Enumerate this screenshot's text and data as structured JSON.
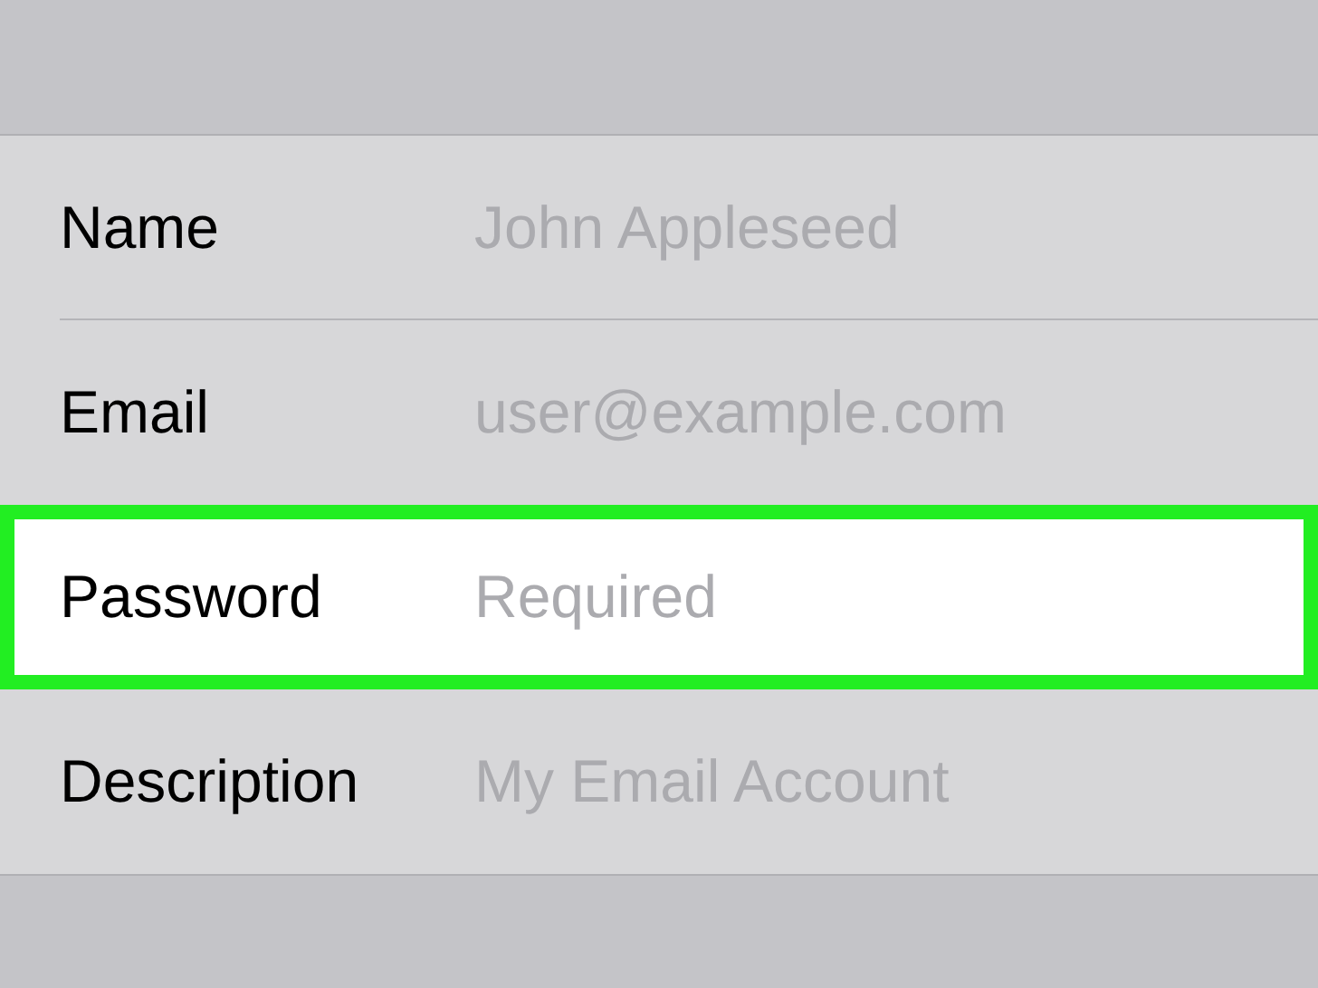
{
  "rows": [
    {
      "label": "Name",
      "placeholder": "John Appleseed",
      "highlighted": false
    },
    {
      "label": "Email",
      "placeholder": "user@example.com",
      "highlighted": false
    },
    {
      "label": "Password",
      "placeholder": "Required",
      "highlighted": true
    },
    {
      "label": "Description",
      "placeholder": "My Email Account",
      "highlighted": false
    }
  ]
}
